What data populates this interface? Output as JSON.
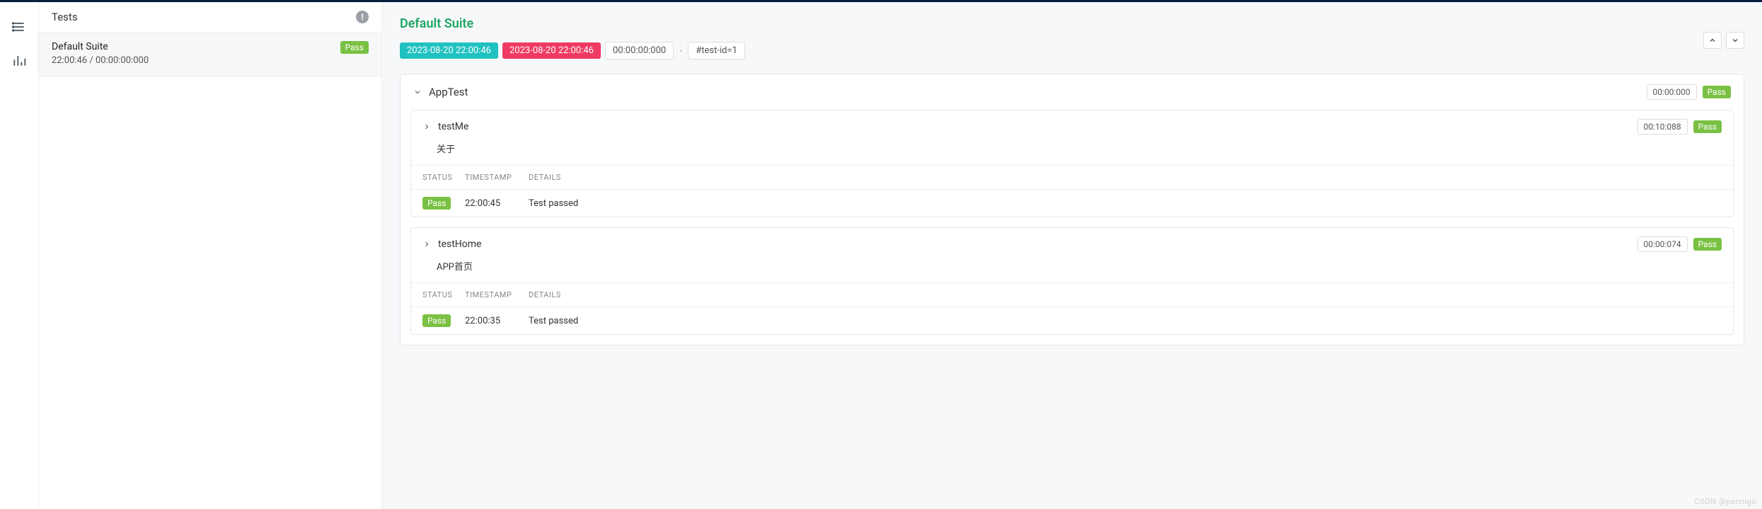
{
  "nav": {
    "icons": [
      "list-icon",
      "chart-icon"
    ]
  },
  "leftPanel": {
    "title": "Tests",
    "infoGlyph": "!",
    "suite": {
      "name": "Default Suite",
      "timeline": "22:00:46 / 00:00:00:000",
      "status": "Pass"
    }
  },
  "main": {
    "suiteTitle": "Default Suite",
    "chips": {
      "start": "2023-08-20 22:00:46",
      "end": "2023-08-20 22:00:46",
      "duration": "00:00:00:000",
      "tag": "#test-id=1"
    },
    "classCard": {
      "name": "AppTest",
      "duration": "00:00:000",
      "status": "Pass"
    },
    "tests": [
      {
        "name": "testMe",
        "desc": "关于",
        "duration": "00:10:088",
        "status": "Pass",
        "headers": {
          "status": "STATUS",
          "timestamp": "TIMESTAMP",
          "details": "DETAILS"
        },
        "log": {
          "status": "Pass",
          "timestamp": "22:00:45",
          "details": "Test passed"
        }
      },
      {
        "name": "testHome",
        "desc": "APP首页",
        "duration": "00:00:074",
        "status": "Pass",
        "headers": {
          "status": "STATUS",
          "timestamp": "TIMESTAMP",
          "details": "DETAILS"
        },
        "log": {
          "status": "Pass",
          "timestamp": "22:00:35",
          "details": "Test passed"
        }
      }
    ]
  },
  "watermark": "CSDN @pennigo"
}
